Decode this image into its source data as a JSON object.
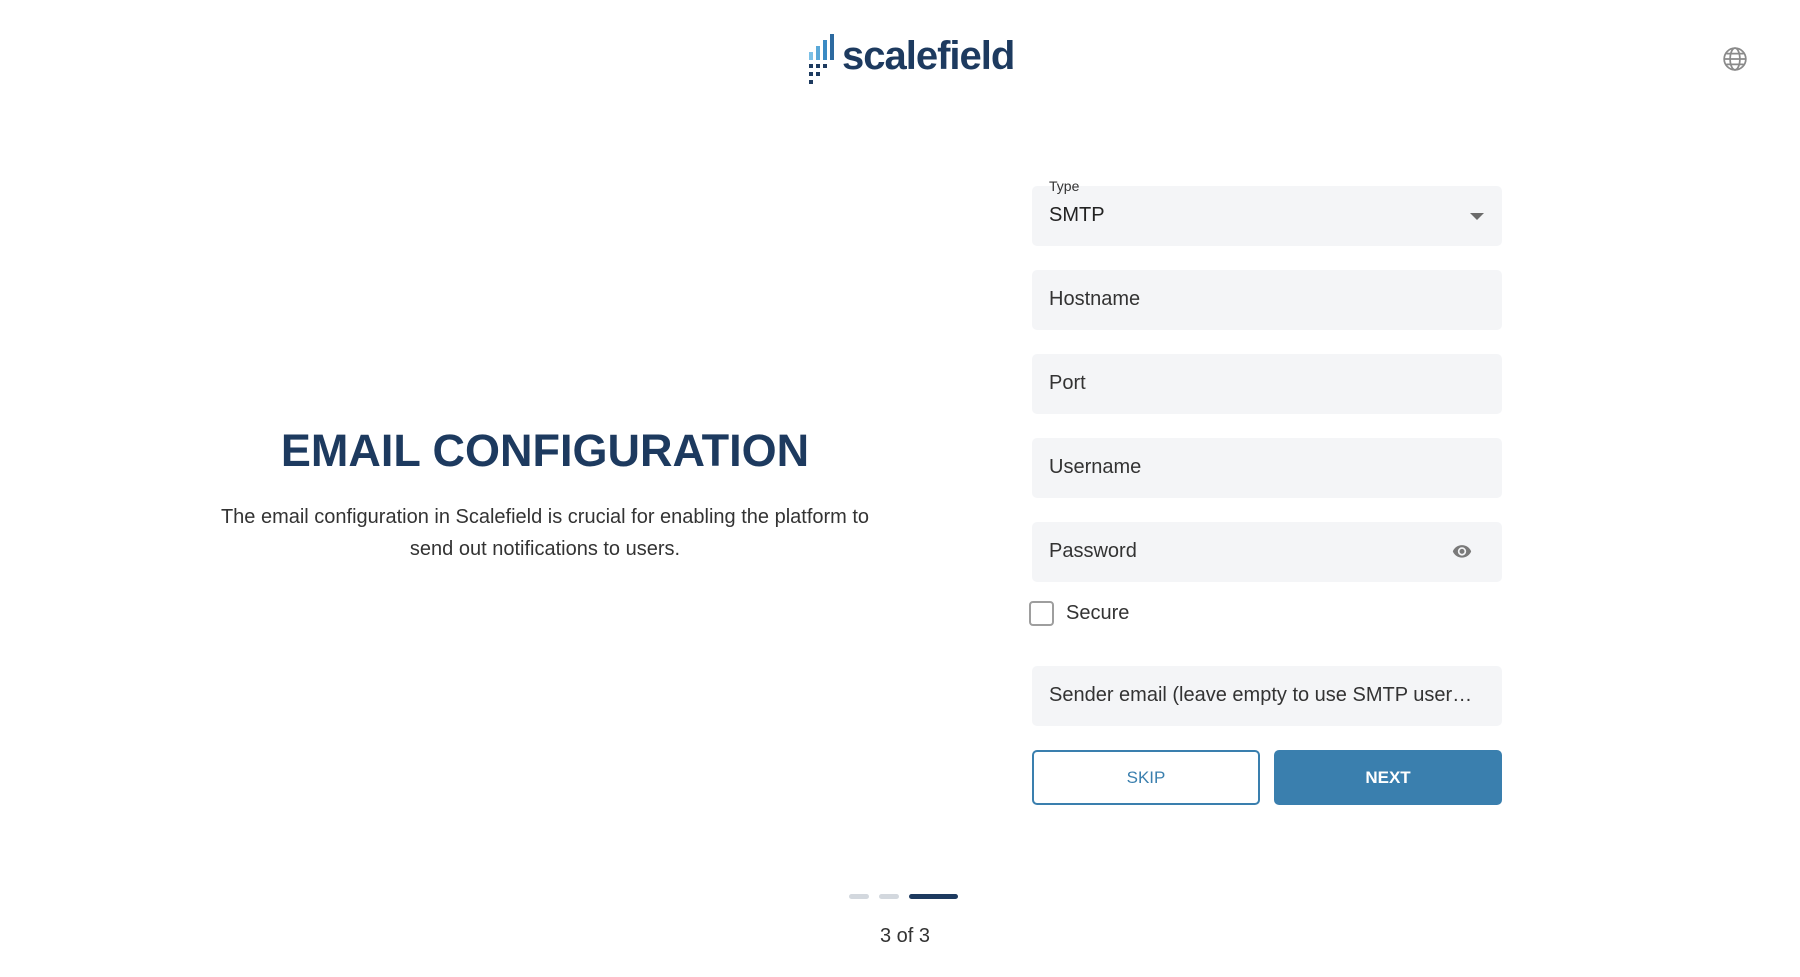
{
  "header": {
    "logo_text": "scalefield",
    "language_icon": "globe-icon"
  },
  "intro": {
    "title": "EMAIL CONFIGURATION",
    "description": "The email configuration in Scalefield is crucial for enabling the platform to send out notifications to users."
  },
  "form": {
    "type": {
      "label": "Type",
      "value": "SMTP",
      "options": [
        "SMTP"
      ]
    },
    "hostname": {
      "placeholder": "Hostname",
      "value": ""
    },
    "port": {
      "placeholder": "Port",
      "value": ""
    },
    "username": {
      "placeholder": "Username",
      "value": ""
    },
    "password": {
      "placeholder": "Password",
      "value": "",
      "toggle_icon": "eye-icon"
    },
    "secure": {
      "label": "Secure",
      "checked": false
    },
    "sender_email": {
      "placeholder": "Sender email (leave empty to use SMTP username)",
      "value": ""
    }
  },
  "actions": {
    "skip_label": "SKIP",
    "next_label": "NEXT"
  },
  "pager": {
    "current": 3,
    "total": 3,
    "text": "3 of 3"
  },
  "colors": {
    "brand_dark": "#1d3a5f",
    "accent": "#3a7fae",
    "field_bg": "#f4f5f7"
  }
}
